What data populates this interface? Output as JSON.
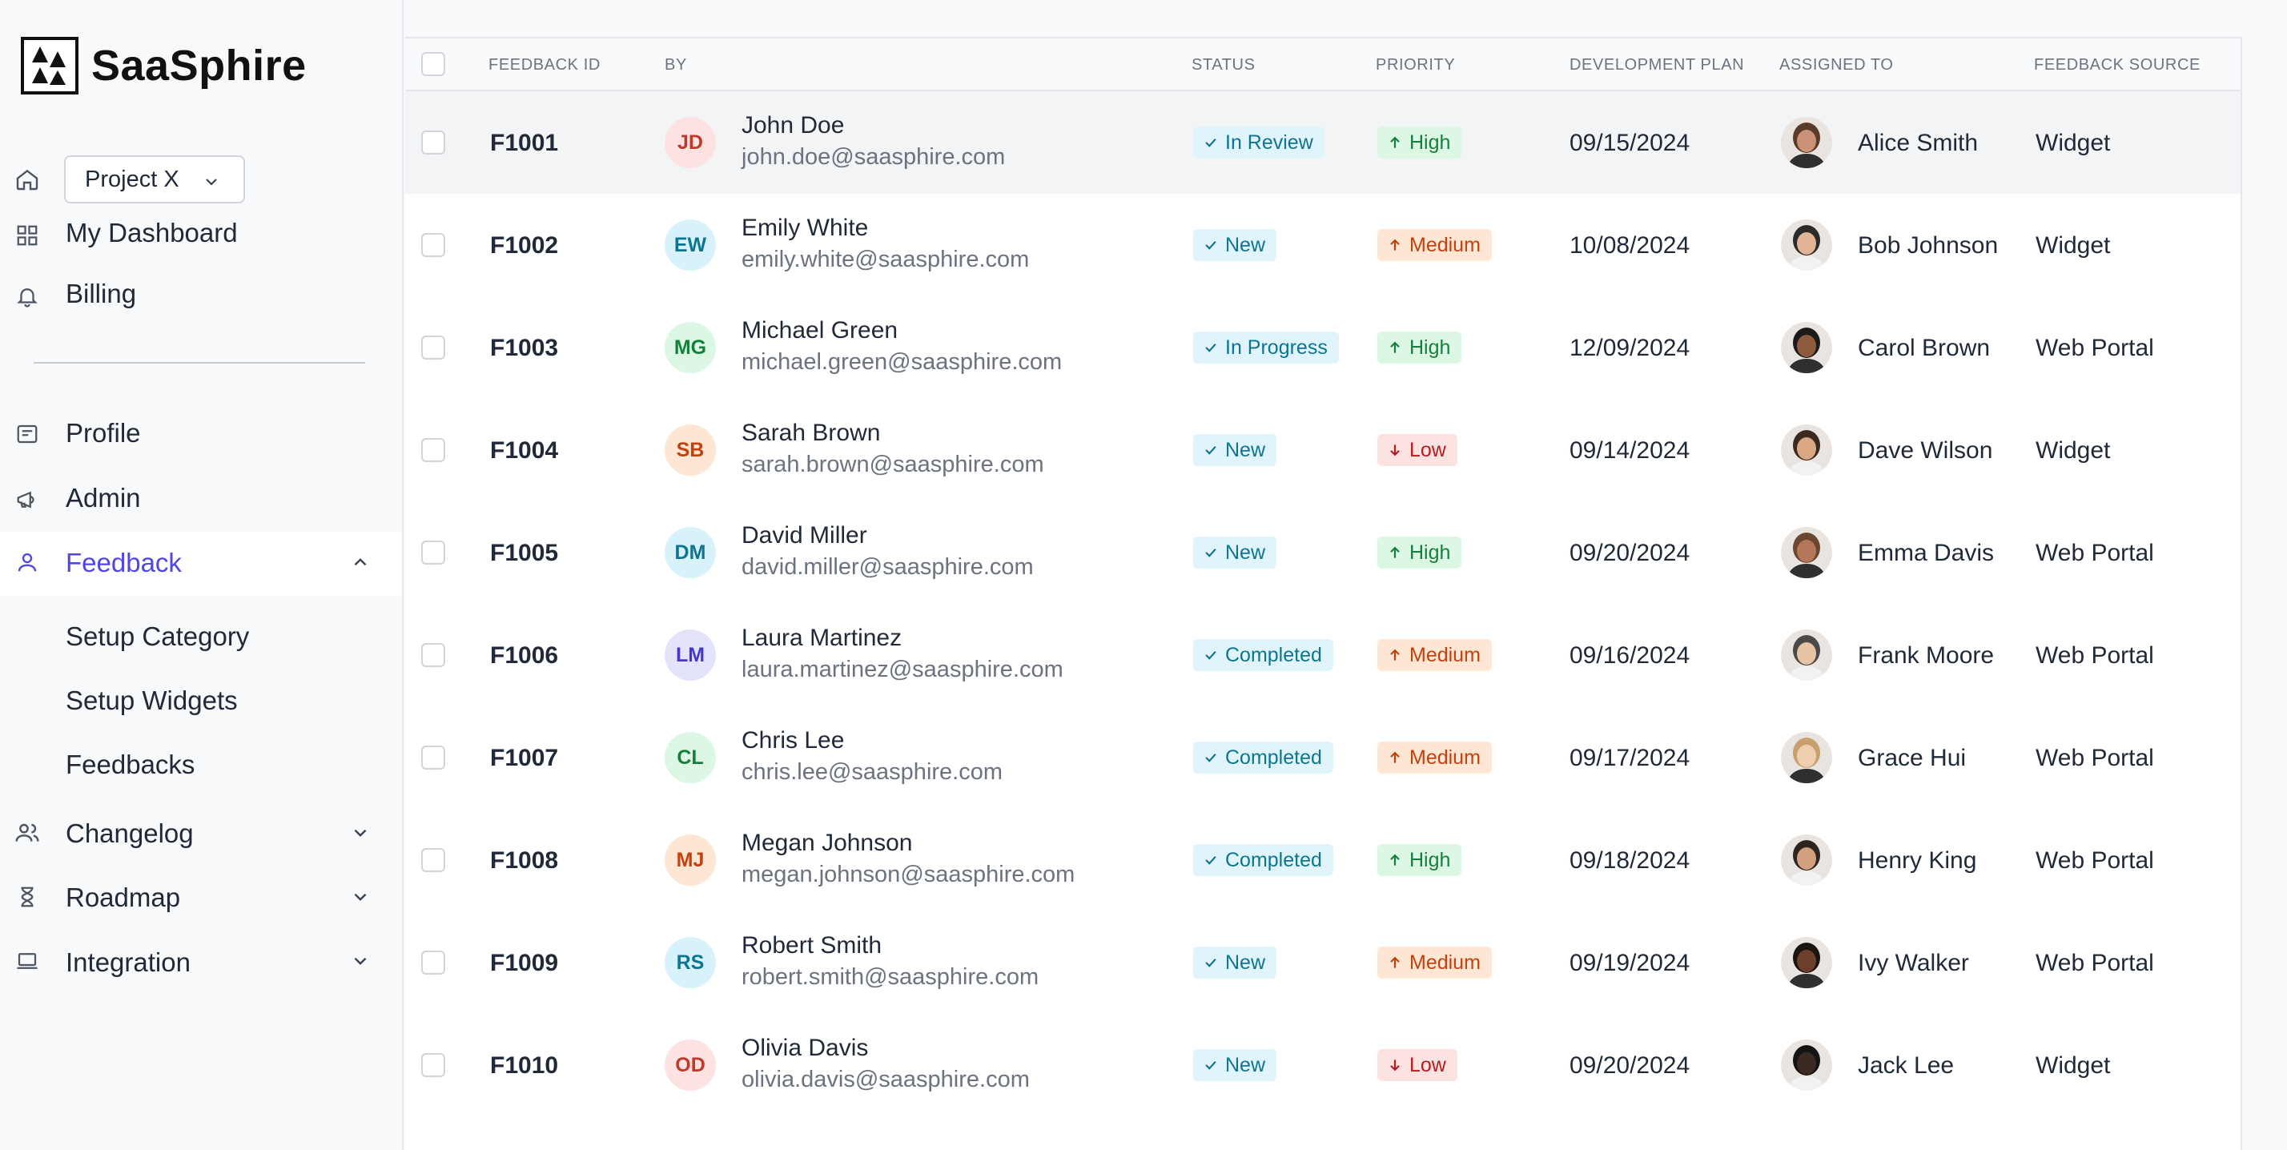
{
  "brand": {
    "name": "SaaSphire"
  },
  "project_selector": {
    "value": "Project X"
  },
  "nav": {
    "dashboard": "My Dashboard",
    "billing": "Billing",
    "profile": "Profile",
    "admin": "Admin",
    "feedback": "Feedback",
    "feedback_sub": [
      "Setup Category",
      "Setup Widgets",
      "Feedbacks"
    ],
    "changelog": "Changelog",
    "roadmap": "Roadmap",
    "integration": "Integration"
  },
  "table": {
    "headers": {
      "id": "FEEDBACK ID",
      "by": "BY",
      "status": "STATUS",
      "priority": "PRIORITY",
      "plan": "DEVELOPMENT PLAN",
      "assigned": "ASSIGNED TO",
      "source": "FEEDBACK SOURCE"
    },
    "rows": [
      {
        "id": "F1001",
        "initials": "JD",
        "name": "John Doe",
        "email": "john.doe@saasphire.com",
        "status": "In Review",
        "priority": "High",
        "plan": "09/15/2024",
        "assignee": "Alice Smith",
        "source": "Widget"
      },
      {
        "id": "F1002",
        "initials": "EW",
        "name": "Emily White",
        "email": "emily.white@saasphire.com",
        "status": "New",
        "priority": "Medium",
        "plan": "10/08/2024",
        "assignee": "Bob Johnson",
        "source": "Widget"
      },
      {
        "id": "F1003",
        "initials": "MG",
        "name": "Michael Green",
        "email": "michael.green@saasphire.com",
        "status": "In Progress",
        "priority": "High",
        "plan": "12/09/2024",
        "assignee": "Carol Brown",
        "source": "Web Portal"
      },
      {
        "id": "F1004",
        "initials": "SB",
        "name": "Sarah Brown",
        "email": "sarah.brown@saasphire.com",
        "status": "New",
        "priority": "Low",
        "plan": "09/14/2024",
        "assignee": "Dave Wilson",
        "source": "Widget"
      },
      {
        "id": "F1005",
        "initials": "DM",
        "name": "David Miller",
        "email": "david.miller@saasphire.com",
        "status": "New",
        "priority": "High",
        "plan": "09/20/2024",
        "assignee": "Emma Davis",
        "source": "Web Portal"
      },
      {
        "id": "F1006",
        "initials": "LM",
        "name": "Laura Martinez",
        "email": "laura.martinez@saasphire.com",
        "status": "Completed",
        "priority": "Medium",
        "plan": "09/16/2024",
        "assignee": "Frank Moore",
        "source": "Web Portal"
      },
      {
        "id": "F1007",
        "initials": "CL",
        "name": "Chris Lee",
        "email": "chris.lee@saasphire.com",
        "status": "Completed",
        "priority": "Medium",
        "plan": "09/17/2024",
        "assignee": "Grace Hui",
        "source": "Web Portal"
      },
      {
        "id": "F1008",
        "initials": "MJ",
        "name": "Megan Johnson",
        "email": "megan.johnson@saasphire.com",
        "status": "Completed",
        "priority": "High",
        "plan": "09/18/2024",
        "assignee": "Henry King",
        "source": "Web Portal"
      },
      {
        "id": "F1009",
        "initials": "RS",
        "name": "Robert Smith",
        "email": "robert.smith@saasphire.com",
        "status": "New",
        "priority": "Medium",
        "plan": "09/19/2024",
        "assignee": "Ivy Walker",
        "source": "Web Portal"
      },
      {
        "id": "F1010",
        "initials": "OD",
        "name": "Olivia Davis",
        "email": "olivia.davis@saasphire.com",
        "status": "New",
        "priority": "Low",
        "plan": "09/20/2024",
        "assignee": "Jack Lee",
        "source": "Widget"
      }
    ]
  },
  "colors": {
    "accent": "#4f46e5",
    "status_bg": "#e0f5fb",
    "status_text": "#0e7490",
    "high": "#15803d",
    "medium": "#c2410c",
    "low": "#b91c1c"
  }
}
